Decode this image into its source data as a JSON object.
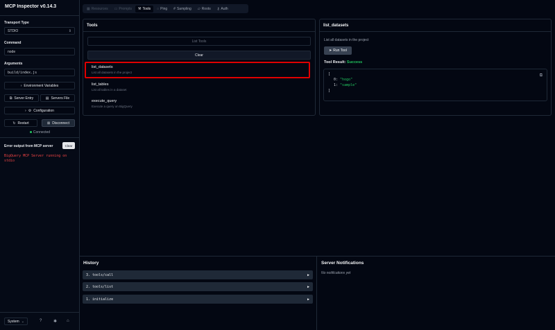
{
  "app": {
    "title": "MCP Inspector v0.14.3"
  },
  "sidebar": {
    "transport_label": "Transport Type",
    "transport_value": "STDIO",
    "command_label": "Command",
    "command_value": "node",
    "arguments_label": "Arguments",
    "arguments_value": "build/index.js",
    "env_button": "Environment Variables",
    "server_entry_button": "Server Entry",
    "servers_file_button": "Servers File",
    "configuration_button": "Configuration",
    "restart_button": "Restart",
    "disconnect_button": "Disconnect",
    "status": "Connected",
    "error_label": "Error output from MCP server",
    "error_clear": "Clear",
    "error_text": "BigQuery MCP Server running on stdio",
    "theme_value": "System"
  },
  "tabs": [
    {
      "label": "Resources",
      "icon": "files-icon"
    },
    {
      "label": "Prompts",
      "icon": "message-icon"
    },
    {
      "label": "Tools",
      "icon": "wrench-icon"
    },
    {
      "label": "Ping",
      "icon": "bell-icon"
    },
    {
      "label": "Sampling",
      "icon": "hash-icon"
    },
    {
      "label": "Roots",
      "icon": "folder-icon"
    },
    {
      "label": "Auth",
      "icon": "key-icon"
    }
  ],
  "tools_panel": {
    "title": "Tools",
    "list_button": "List Tools",
    "clear_button": "Clear",
    "items": [
      {
        "name": "list_datasets",
        "description": "List all datasets in the project"
      },
      {
        "name": "list_tables",
        "description": "List all tables in a dataset"
      },
      {
        "name": "execute_query",
        "description": "Execute a query on BigQuery"
      }
    ]
  },
  "result_panel": {
    "title": "list_datasets",
    "description": "List all datasets in the project",
    "run_button": "Run Tool",
    "result_label": "Tool Result:",
    "result_status": "Success",
    "json_open": "[",
    "json_items": [
      {
        "index": "0:",
        "value": "\"hogo\""
      },
      {
        "index": "1:",
        "value": "\"sample\""
      }
    ],
    "json_close": "]"
  },
  "history": {
    "title": "History",
    "items": [
      "3. tools/call",
      "2. tools/list",
      "1. initialize"
    ]
  },
  "notifications": {
    "title": "Server Notifications",
    "empty": "No notifications yet"
  },
  "colors": {
    "background": "#030712",
    "highlight": "#e00000",
    "success": "#22c55e",
    "error": "#ef4444"
  }
}
